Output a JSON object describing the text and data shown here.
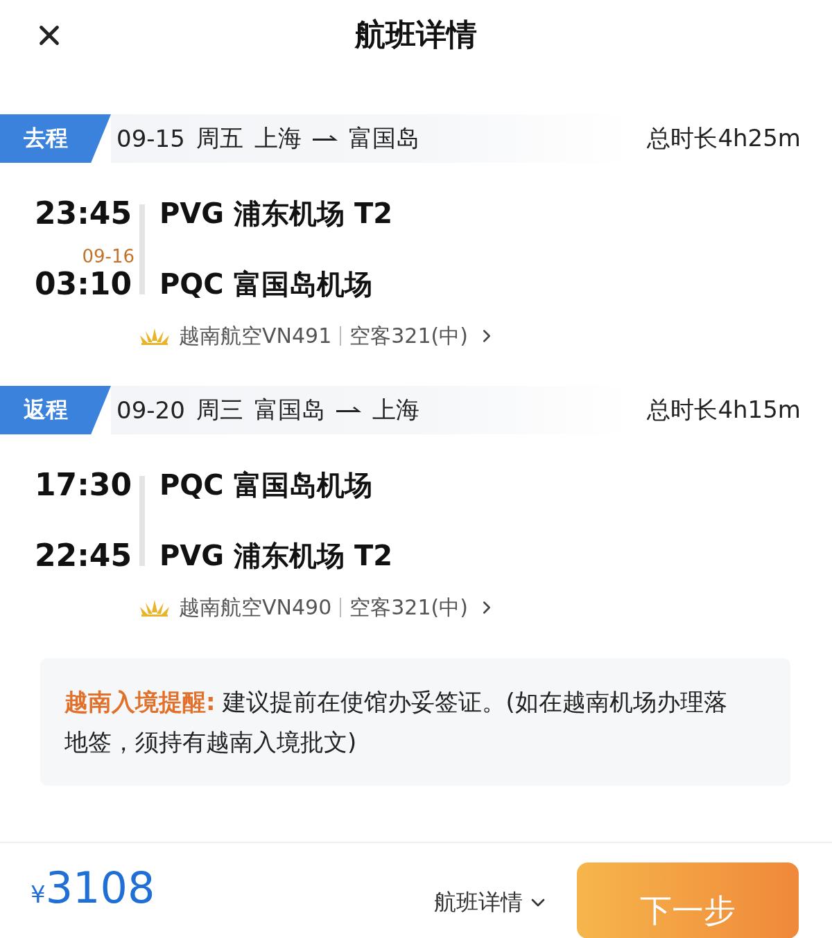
{
  "header": {
    "title": "航班详情"
  },
  "legs": [
    {
      "tag": "去程",
      "date": "09-15",
      "weekday": "周五",
      "from": "上海",
      "to": "富国岛",
      "duration": "总时长4h25m",
      "depart_time": "23:45",
      "depart_airport": "PVG 浦东机场 T2",
      "arrive_date": "09-16",
      "arrive_time": "03:10",
      "arrive_airport": "PQC 富国岛机场",
      "flight": "越南航空VN491",
      "aircraft": "空客321(中)"
    },
    {
      "tag": "返程",
      "date": "09-20",
      "weekday": "周三",
      "from": "富国岛",
      "to": "上海",
      "duration": "总时长4h15m",
      "depart_time": "17:30",
      "depart_airport": "PQC 富国岛机场",
      "arrive_time": "22:45",
      "arrive_airport": "PVG 浦东机场 T2",
      "flight": "越南航空VN490",
      "aircraft": "空客321(中)"
    }
  ],
  "notice": {
    "label": "越南入境提醒:",
    "text": "建议提前在使馆办妥签证。(如在越南机场办理落地签，须持有越南入境批文)"
  },
  "footer": {
    "currency": "¥",
    "price": "3108",
    "details_link": "航班详情",
    "next_button": "下一步"
  }
}
